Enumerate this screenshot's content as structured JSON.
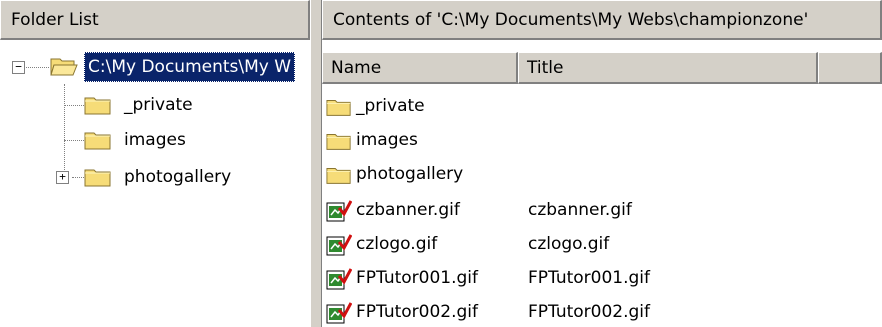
{
  "folder_pane": {
    "header": "Folder List",
    "root": {
      "label": "C:\\My Documents\\My W",
      "expanded": true
    },
    "children": [
      {
        "label": "_private",
        "expandable": false
      },
      {
        "label": "images",
        "expandable": false
      },
      {
        "label": "photogallery",
        "expandable": true
      }
    ]
  },
  "contents_pane": {
    "header": "Contents of 'C:\\My Documents\\My Webs\\championzone'",
    "columns": [
      {
        "label": "Name"
      },
      {
        "label": "Title"
      },
      {
        "label": ""
      }
    ],
    "rows": [
      {
        "name": "_private",
        "title": "",
        "icon": "folder-icon"
      },
      {
        "name": "images",
        "title": "",
        "icon": "folder-icon"
      },
      {
        "name": "photogallery",
        "title": "",
        "icon": "folder-icon"
      },
      {
        "name": "czbanner.gif",
        "title": "czbanner.gif",
        "icon": "gif-image-icon"
      },
      {
        "name": "czlogo.gif",
        "title": "czlogo.gif",
        "icon": "gif-image-icon"
      },
      {
        "name": "FPTutor001.gif",
        "title": "FPTutor001.gif",
        "icon": "gif-image-icon"
      },
      {
        "name": "FPTutor002.gif",
        "title": "FPTutor002.gif",
        "icon": "gif-image-icon"
      }
    ]
  },
  "expander_glyphs": {
    "expanded": "−",
    "collapsed": "+"
  },
  "colors": {
    "chrome": "#d4d0c8",
    "selection": "#0a246a",
    "folder": "#f5d868"
  }
}
